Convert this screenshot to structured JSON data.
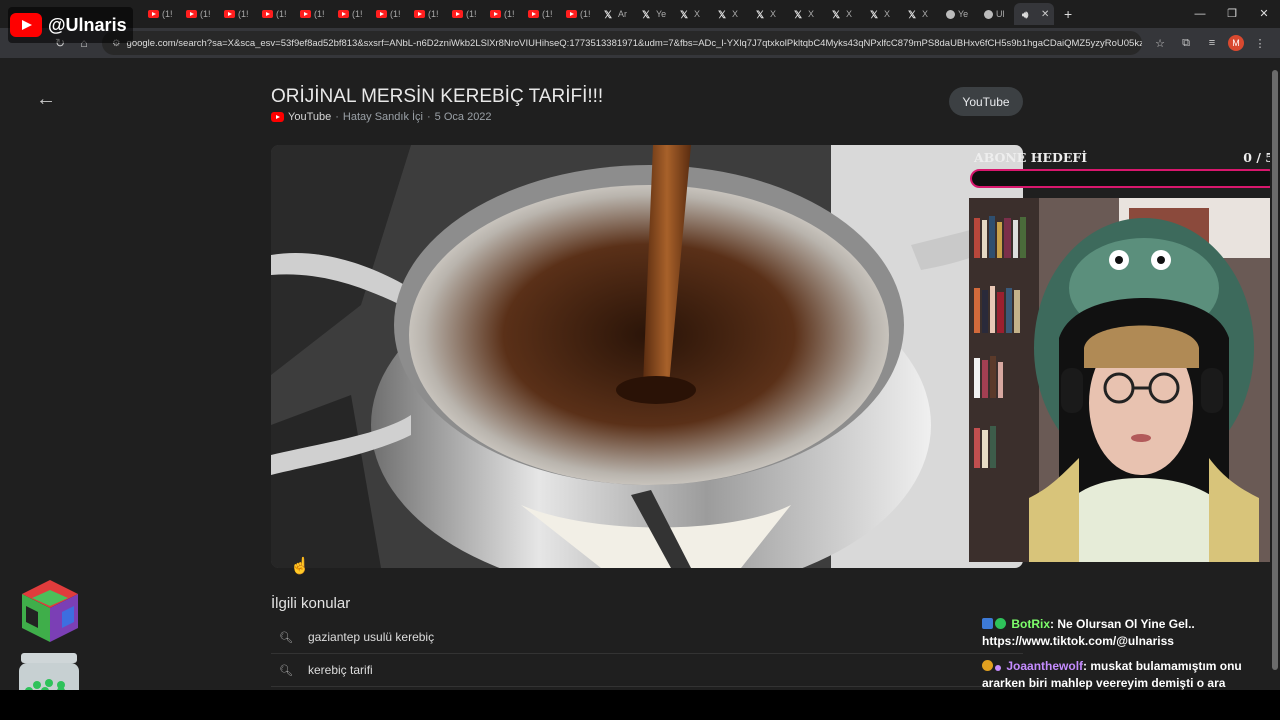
{
  "overlay": {
    "channel": "@Ulnaris"
  },
  "browser": {
    "tabs": [
      {
        "label": "(1!",
        "icon": "youtube-icon"
      },
      {
        "label": "(1!",
        "icon": "youtube-icon"
      },
      {
        "label": "(1!",
        "icon": "youtube-icon"
      },
      {
        "label": "(1!",
        "icon": "youtube-icon"
      },
      {
        "label": "(1!",
        "icon": "youtube-icon"
      },
      {
        "label": "(1!",
        "icon": "youtube-icon"
      },
      {
        "label": "(1!",
        "icon": "youtube-icon"
      },
      {
        "label": "(1!",
        "icon": "youtube-icon"
      },
      {
        "label": "(1!",
        "icon": "youtube-icon"
      },
      {
        "label": "(1!",
        "icon": "youtube-icon"
      },
      {
        "label": "(1!",
        "icon": "youtube-icon"
      },
      {
        "label": "(1!",
        "icon": "youtube-icon"
      },
      {
        "label": "Ar",
        "icon": "x-icon"
      },
      {
        "label": "Ye",
        "icon": "x-icon"
      },
      {
        "label": "X",
        "icon": "x-icon"
      },
      {
        "label": "X",
        "icon": "x-icon"
      },
      {
        "label": "X",
        "icon": "x-icon"
      },
      {
        "label": "X",
        "icon": "x-icon"
      },
      {
        "label": "X",
        "icon": "x-icon"
      },
      {
        "label": "X",
        "icon": "x-icon"
      },
      {
        "label": "X",
        "icon": "x-icon"
      },
      {
        "label": "Ye",
        "icon": "globe-icon"
      },
      {
        "label": "Ul",
        "icon": "globe-icon"
      },
      {
        "label": "",
        "icon": "speaker-icon",
        "active": true
      }
    ],
    "new_tab": "+",
    "url": "google.com/search?sa=X&sca_esv=53f9ef8ad52bf813&sxsrf=ANbL-n6D2zniWkb2LSlXr8NroVIUHihseQ:1773513381971&udm=7&fbs=ADc_l-YXlq7J7qtxkolPkltqbC4Myks43qNPxlfcC879mPS8daUBHxv6fCH5s9b1hgaCDaiQMZ5yzyRoU05kzBNa...",
    "profile_initial": "M"
  },
  "result": {
    "title": "ORİJİNAL MERSİN KEREBİÇ TARİFİ!!!",
    "source": "YouTube",
    "channel": "Hatay Sandık İçi",
    "date": "5 Oca 2022",
    "source_button": "YouTube"
  },
  "related": {
    "heading": "İlgili konular",
    "items": [
      "gaziantep usulü kerebiç",
      "kerebiç tarifi"
    ]
  },
  "sub_goal": {
    "label": "ABONE HEDEFİ",
    "current": "0",
    "separator": "/",
    "target": "5",
    "progress": 0
  },
  "chat": [
    {
      "user": "BotRix",
      "user_color": "#7dff6b",
      "text": "Ne Olursan Ol Yine Gel.. https://www.tiktok.com/@ulnariss"
    },
    {
      "user": "Joaanthewolf",
      "user_color": "#c58cff",
      "text": "muskat bulamamıştım onu ararken biri mahlep veereyim demişti o ara öğrendim ama almadım"
    }
  ],
  "colors": {
    "accent": "#d8176d",
    "youtube_red": "#ff0000",
    "background": "#1f1f1f"
  }
}
